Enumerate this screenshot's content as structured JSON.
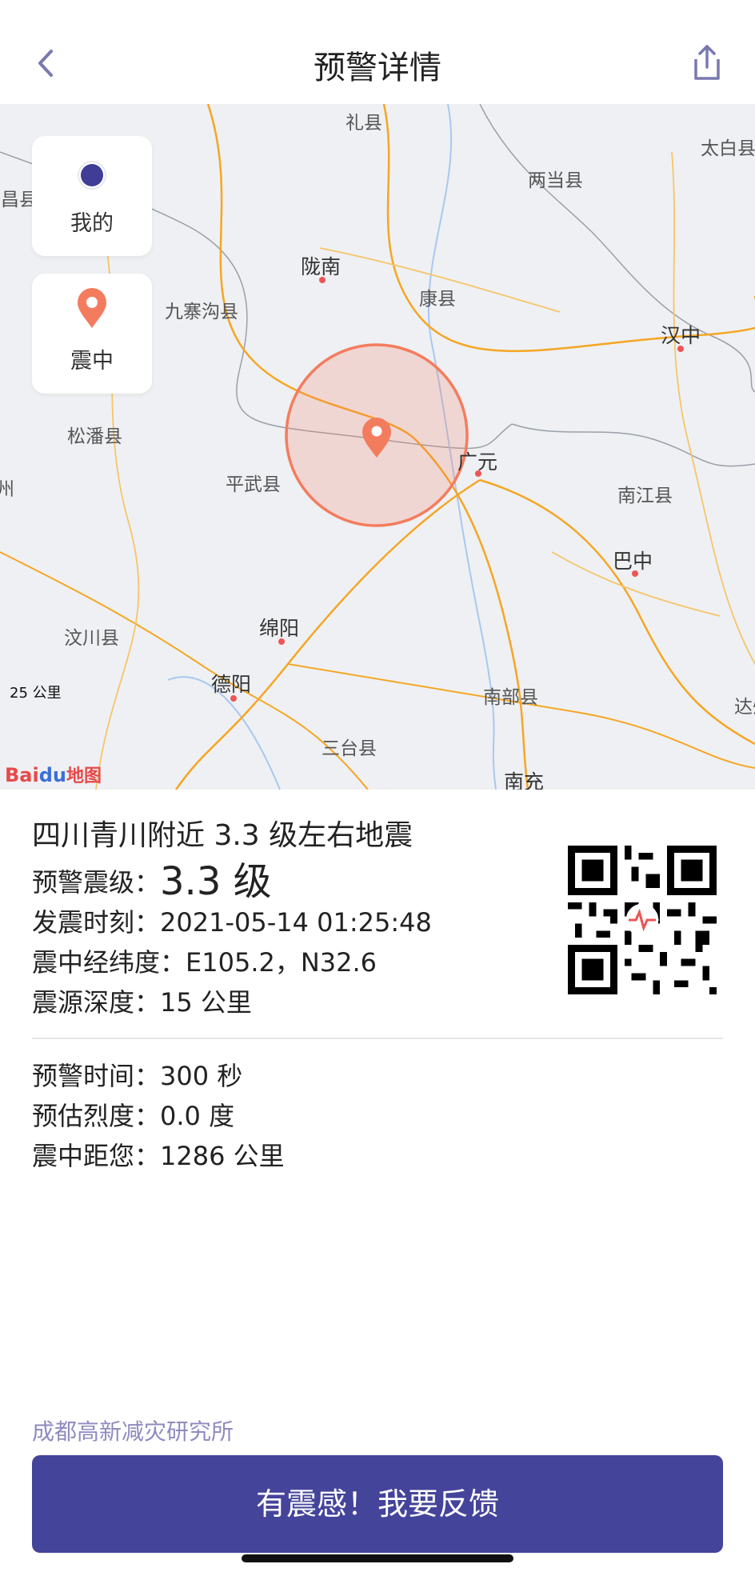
{
  "nav": {
    "title": "预警详情",
    "back_icon": "chevron-left-icon",
    "share_icon": "share-icon"
  },
  "map": {
    "places": [
      "礼县",
      "太白县",
      "两当县",
      "宕昌县",
      "陇南",
      "康县",
      "九寨沟县",
      "汉中",
      "松潘县",
      "广元",
      "平武县",
      "南江县",
      "茂州",
      "巴中",
      "绵阳",
      "汶川县",
      "南部县",
      "德阳",
      "三台县",
      "南充",
      "达州"
    ],
    "my_location_label": "我的",
    "epicenter_label": "震中",
    "scale_label": "25 公里",
    "logo_text": "Bai地图"
  },
  "event": {
    "headline": "四川青川附近 3.3 级左右地震",
    "magnitude_label": "预警震级：",
    "magnitude_value": "3.3 级",
    "time_label": "发震时刻：",
    "time_value": "2021-05-14 01:25:48",
    "coord_label": "震中经纬度：",
    "coord_value": "E105.2，N32.6",
    "depth_label": "震源深度：",
    "depth_value": "15 公里"
  },
  "warning": {
    "warn_time_label": "预警时间：",
    "warn_time_value": "300 秒",
    "intensity_label": "预估烈度：",
    "intensity_value": "0.0 度",
    "distance_label": "震中距您：",
    "distance_value": "1286 公里"
  },
  "footer": {
    "org": "成都高新减灾研究所",
    "feedback_button": "有震感！我要反馈"
  },
  "colors": {
    "accent": "#45449b",
    "epicenter": "#f47c5e",
    "org_text": "#8f8ac0"
  }
}
